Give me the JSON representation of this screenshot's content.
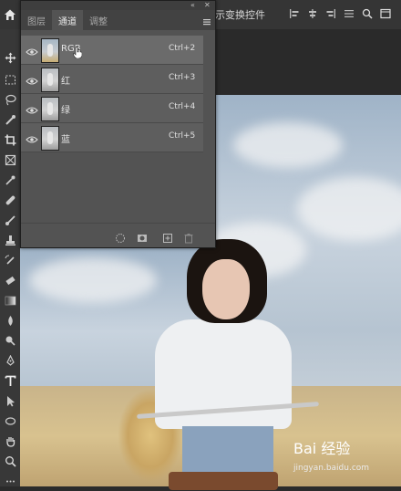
{
  "app": {
    "options_bar_text": "示变换控件"
  },
  "panel": {
    "tabs": [
      {
        "label": "图层",
        "active": false
      },
      {
        "label": "通道",
        "active": true
      },
      {
        "label": "调整",
        "active": false
      }
    ],
    "channels": [
      {
        "name": "RGB",
        "shortcut": "Ctrl+2",
        "thumb": "rgb",
        "selected": true
      },
      {
        "name": "红",
        "shortcut": "Ctrl+3",
        "thumb": "gray",
        "selected": false
      },
      {
        "name": "绿",
        "shortcut": "Ctrl+4",
        "thumb": "gray",
        "selected": false
      },
      {
        "name": "蓝",
        "shortcut": "Ctrl+5",
        "thumb": "gray",
        "selected": false
      }
    ]
  },
  "watermark": {
    "logo_text": "Bai 经验",
    "url": "jingyan.baidu.com"
  },
  "colors": {
    "panel_bg": "#535353",
    "row_bg": "#5e5e5e",
    "selected_row_bg": "#6b6b6b"
  }
}
